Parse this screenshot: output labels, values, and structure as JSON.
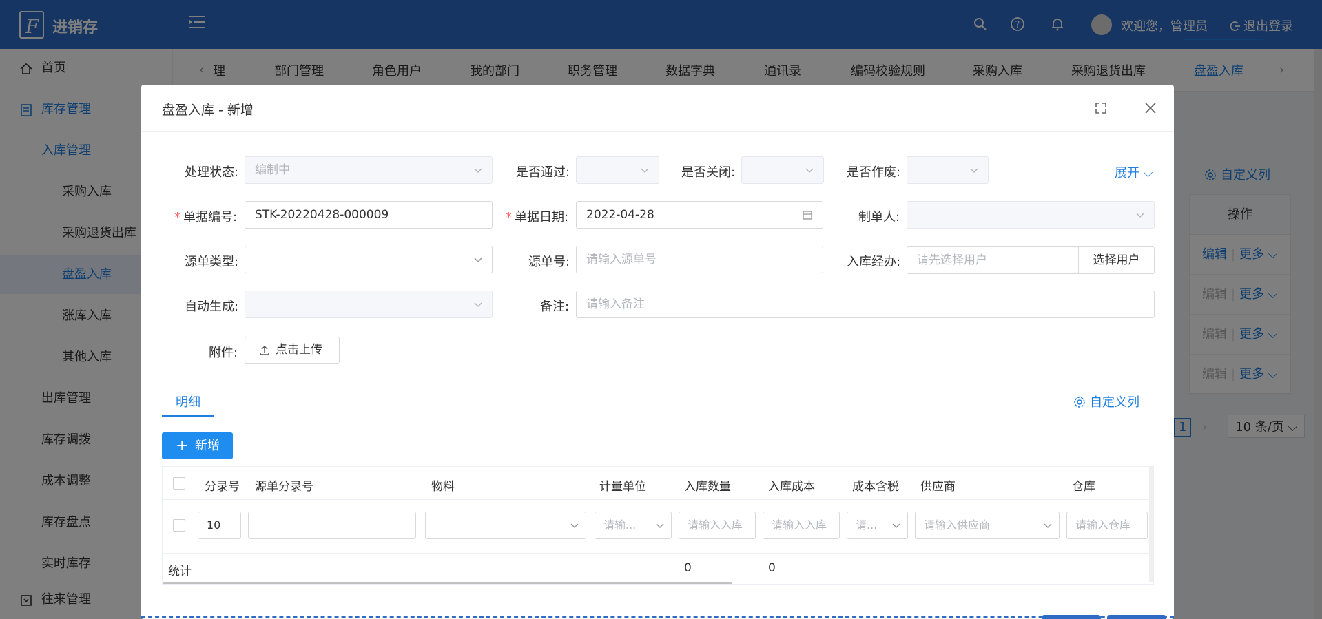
{
  "header": {
    "app_name": "进销存",
    "welcome": "欢迎您，管理员",
    "logout": "退出登录",
    "bg_color": "#2d6bc4"
  },
  "sidebar": {
    "items": [
      {
        "label": "首页",
        "icon": "home-icon"
      },
      {
        "label": "库存管理",
        "icon": "inventory-icon"
      },
      {
        "label": "入库管理"
      },
      {
        "label": "采购入库"
      },
      {
        "label": "采购退货出库"
      },
      {
        "label": "盘盈入库"
      },
      {
        "label": "涨库入库"
      },
      {
        "label": "其他入库"
      },
      {
        "label": "出库管理"
      },
      {
        "label": "库存调拨"
      },
      {
        "label": "成本调整"
      },
      {
        "label": "库存盘点"
      },
      {
        "label": "实时库存"
      },
      {
        "label": "往来管理",
        "icon": "contacts-icon"
      }
    ]
  },
  "tabs": {
    "items": [
      "理",
      "部门管理",
      "角色用户",
      "我的部门",
      "职务管理",
      "数据字典",
      "通讯录",
      "编码校验规则",
      "采购入库",
      "采购退货出库",
      "盘盈入库"
    ],
    "active": "盘盈入库"
  },
  "background": {
    "custom_columns": "自定义列",
    "op_header": "操作",
    "edit": "编辑",
    "more": "更多",
    "page_num": "1",
    "page_size": "10 条/页"
  },
  "modal": {
    "title": "盘盈入库 - 新增",
    "form": {
      "status_label": "处理状态:",
      "status_value": "编制中",
      "passed_label": "是否通过:",
      "closed_label": "是否关闭:",
      "voided_label": "是否作废:",
      "expand": "展开",
      "bill_no_label": "单据编号:",
      "bill_no_value": "STK-20220428-000009",
      "bill_date_label": "单据日期:",
      "bill_date_value": "2022-04-28",
      "maker_label": "制单人:",
      "source_type_label": "源单类型:",
      "source_no_label": "源单号:",
      "source_no_placeholder": "请输入源单号",
      "handler_label": "入库经办:",
      "handler_placeholder": "请先选择用户",
      "select_user": "选择用户",
      "auto_gen_label": "自动生成:",
      "remark_label": "备注:",
      "remark_placeholder": "请输入备注",
      "attach_label": "附件:",
      "upload": "点击上传"
    },
    "detail": {
      "tab": "明细",
      "custom_columns": "自定义列",
      "add": "新增",
      "columns": [
        "分录号",
        "源单分录号",
        "物料",
        "计量单位",
        "入库数量",
        "入库成本",
        "成本含税",
        "供应商",
        "仓库"
      ],
      "row": {
        "entry_no": "10",
        "unit_placeholder": "请输...",
        "qty_placeholder": "请输入入库",
        "cost_placeholder": "请输入入库",
        "tax_placeholder": "请...",
        "supplier_placeholder": "请输入供应商",
        "warehouse_placeholder": "请输入仓库"
      },
      "summary_label": "统计",
      "sum_qty": "0",
      "sum_cost": "0"
    }
  }
}
